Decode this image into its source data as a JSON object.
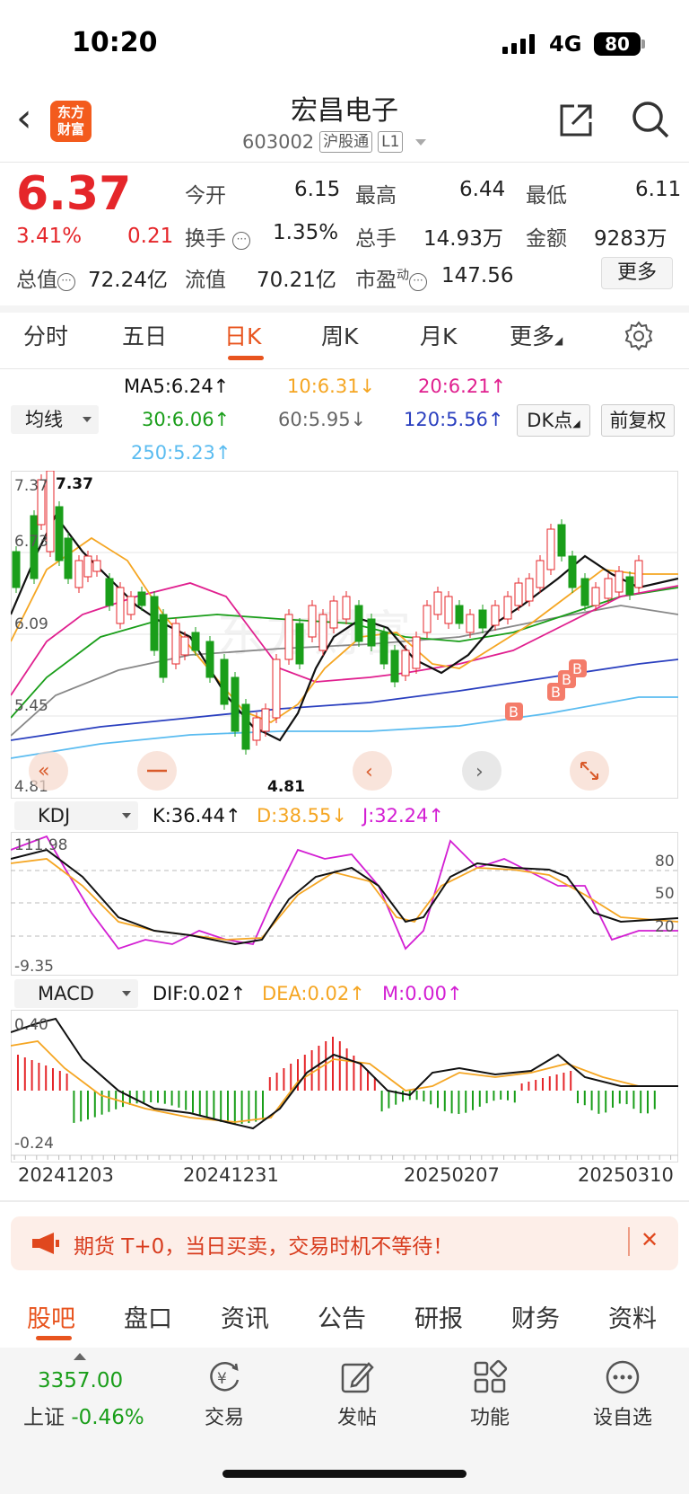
{
  "status": {
    "time": "10:20",
    "network": "4G",
    "battery": "80"
  },
  "header": {
    "title": "宏昌电子",
    "code": "603002",
    "tag1": "沪股通",
    "tag2": "L1",
    "logo_text_1": "东方",
    "logo_text_2": "财富"
  },
  "quote": {
    "price": "6.37",
    "change_pct": "3.41%",
    "change": "0.21",
    "open_label": "今开",
    "open": "6.15",
    "high_label": "最高",
    "high": "6.44",
    "low_label": "最低",
    "low": "6.11",
    "turnover_label": "换手",
    "turnover": "1.35%",
    "volume_label": "总手",
    "volume": "14.93万",
    "amount_label": "金额",
    "amount": "9283万",
    "mcap_label": "总值",
    "mcap": "72.24亿",
    "float_label": "流值",
    "float": "70.21亿",
    "pe_label": "市盈",
    "pe_sup": "动",
    "pe": "147.56",
    "more": "更多"
  },
  "tabs": [
    "分时",
    "五日",
    "日K",
    "周K",
    "月K",
    "更多"
  ],
  "ma_legend": {
    "select": "均线",
    "ma5": "MA5:6.24↑",
    "ma10": "10:6.31↓",
    "ma20": "20:6.21↑",
    "ma30": "30:6.06↑",
    "ma60": "60:5.95↓",
    "ma120": "120:5.56↑",
    "ma250": "250:5.23↑",
    "dk": "DK点",
    "adj": "前复权"
  },
  "kline": {
    "y_labels": [
      "7.37",
      "6.73",
      "6.09",
      "5.45",
      "4.81"
    ],
    "max_note": "7.37",
    "min_note": "4.81",
    "buy_marker": "B",
    "watermark": "东方财富"
  },
  "kdj": {
    "select": "KDJ",
    "k": "K:36.44↑",
    "d": "D:38.55↓",
    "j": "J:32.24↑",
    "y_top": "111.98",
    "y_bottom": "-9.35",
    "levels": [
      "80",
      "50",
      "20"
    ]
  },
  "macd": {
    "select": "MACD",
    "dif": "DIF:0.02↑",
    "dea": "DEA:0.02↑",
    "m": "M:0.00↑",
    "y_top": "0.40",
    "y_bottom": "-0.24"
  },
  "dates": [
    "20241203",
    "20241231",
    "20250207",
    "20250310"
  ],
  "promo": {
    "text": "期货 T+0，当日买卖，交易时机不等待！",
    "close": "✕"
  },
  "bottom_tabs": [
    "股吧",
    "盘口",
    "资讯",
    "公告",
    "研报",
    "财务",
    "资料"
  ],
  "toolbar": {
    "index_value": "3357.00",
    "index_name": "上证",
    "index_change": "-0.46%",
    "trade": "交易",
    "post": "发帖",
    "function": "功能",
    "watchlist": "设自选"
  },
  "colors": {
    "up": "#e5262a",
    "down": "#1a9e1a",
    "accent": "#e8541e",
    "ma5": "#111111",
    "ma10": "#f5a623",
    "ma20": "#e0208f",
    "ma30": "#1a9e1a",
    "ma60": "#888888",
    "ma120": "#2a3fbf",
    "ma250": "#5bbcf0"
  }
}
